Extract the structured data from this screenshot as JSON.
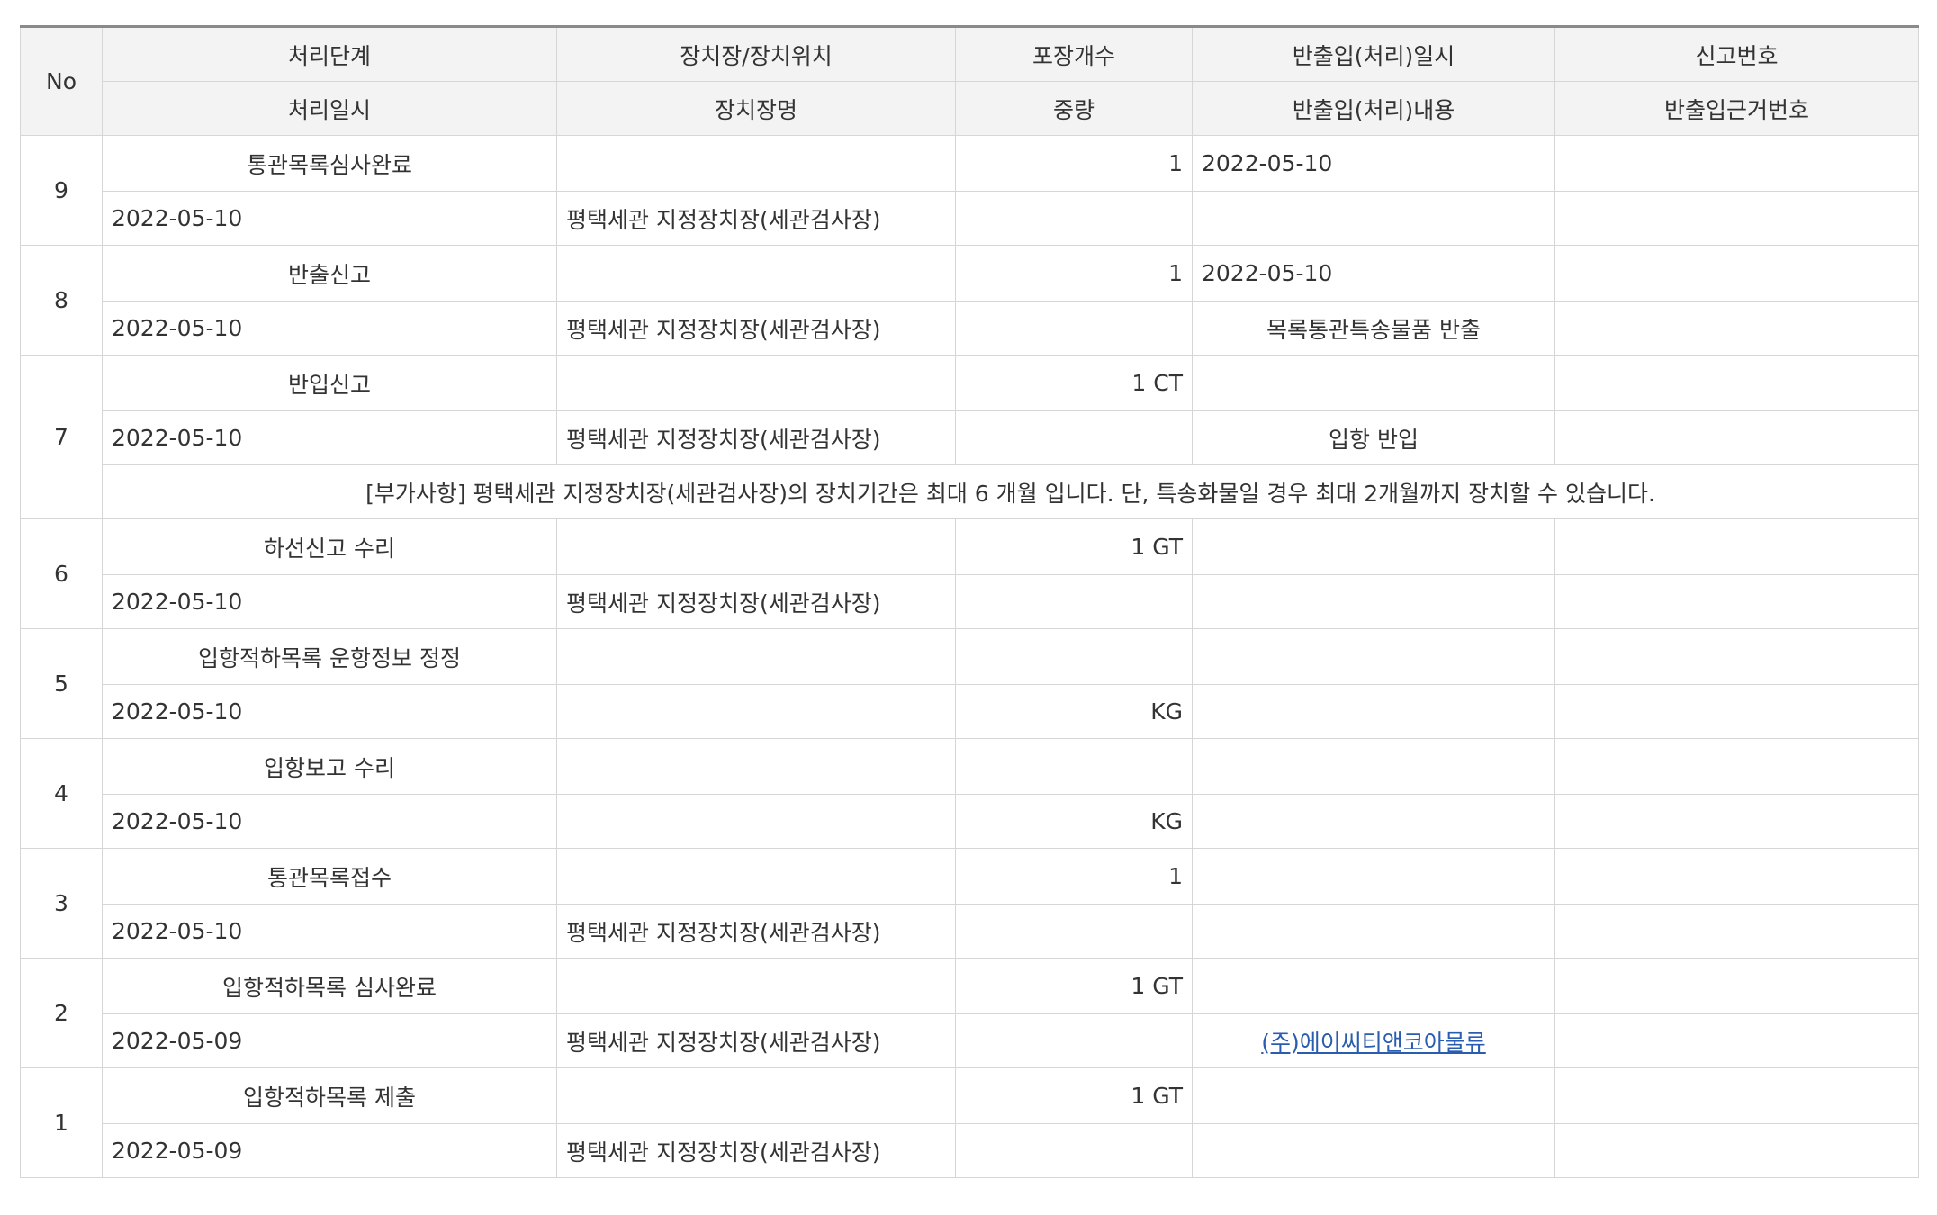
{
  "header": {
    "row1": [
      "No",
      "처리단계",
      "장치장/장치위치",
      "포장개수",
      "반출입(처리)일시",
      "신고번호"
    ],
    "row2": [
      "처리일시",
      "장치장명",
      "중량",
      "반출입(처리)내용",
      "반출입근거번호"
    ]
  },
  "rows": [
    {
      "no": "9",
      "stage": "통관목록심사완료",
      "location": "",
      "pkg": "1",
      "io_time": "2022-05-10",
      "report_no": "",
      "date": "2022-05-10",
      "warehouse": "평택세관 지정장치장(세관검사장)",
      "weight": "",
      "io_content": "",
      "basis_no": ""
    },
    {
      "no": "8",
      "stage": "반출신고",
      "location": "",
      "pkg": "1",
      "io_time": "2022-05-10",
      "report_no": "",
      "date": "2022-05-10",
      "warehouse": "평택세관 지정장치장(세관검사장)",
      "weight": "",
      "io_content": "목록통관특송물품 반출",
      "basis_no": ""
    },
    {
      "no": "7",
      "stage": "반입신고",
      "location": "",
      "pkg": "1 CT",
      "io_time": "",
      "report_no": "",
      "date": "2022-05-10",
      "warehouse": "평택세관 지정장치장(세관검사장)",
      "weight": "",
      "io_content": "입항 반입",
      "basis_no": "",
      "note": "[부가사항] 평택세관 지정장치장(세관검사장)의 장치기간은 최대 6 개월 입니다. 단, 특송화물일 경우 최대 2개월까지 장치할 수 있습니다."
    },
    {
      "no": "6",
      "stage": "하선신고 수리",
      "location": "",
      "pkg": "1 GT",
      "io_time": "",
      "report_no": "",
      "date": "2022-05-10",
      "warehouse": "평택세관 지정장치장(세관검사장)",
      "weight": "",
      "io_content": "",
      "basis_no": ""
    },
    {
      "no": "5",
      "stage": "입항적하목록 운항정보 정정",
      "location": "",
      "pkg": "",
      "io_time": "",
      "report_no": "",
      "date": "2022-05-10",
      "warehouse": "",
      "weight": "KG",
      "io_content": "",
      "basis_no": ""
    },
    {
      "no": "4",
      "stage": "입항보고 수리",
      "location": "",
      "pkg": "",
      "io_time": "",
      "report_no": "",
      "date": "2022-05-10",
      "warehouse": "",
      "weight": "KG",
      "io_content": "",
      "basis_no": ""
    },
    {
      "no": "3",
      "stage": "통관목록접수",
      "location": "",
      "pkg": "1",
      "io_time": "",
      "report_no": "",
      "date": "2022-05-10",
      "warehouse": "평택세관 지정장치장(세관검사장)",
      "weight": "",
      "io_content": "",
      "basis_no": ""
    },
    {
      "no": "2",
      "stage": "입항적하목록 심사완료",
      "location": "",
      "pkg": "1 GT",
      "io_time": "",
      "report_no": "",
      "date": "2022-05-09",
      "warehouse": "평택세관 지정장치장(세관검사장)",
      "weight": "",
      "io_content": "(주)에이씨티앤코아물류",
      "io_content_link": true,
      "basis_no": ""
    },
    {
      "no": "1",
      "stage": "입항적하목록 제출",
      "location": "",
      "pkg": "1 GT",
      "io_time": "",
      "report_no": "",
      "date": "2022-05-09",
      "warehouse": "평택세관 지정장치장(세관검사장)",
      "weight": "",
      "io_content": "",
      "basis_no": ""
    }
  ]
}
